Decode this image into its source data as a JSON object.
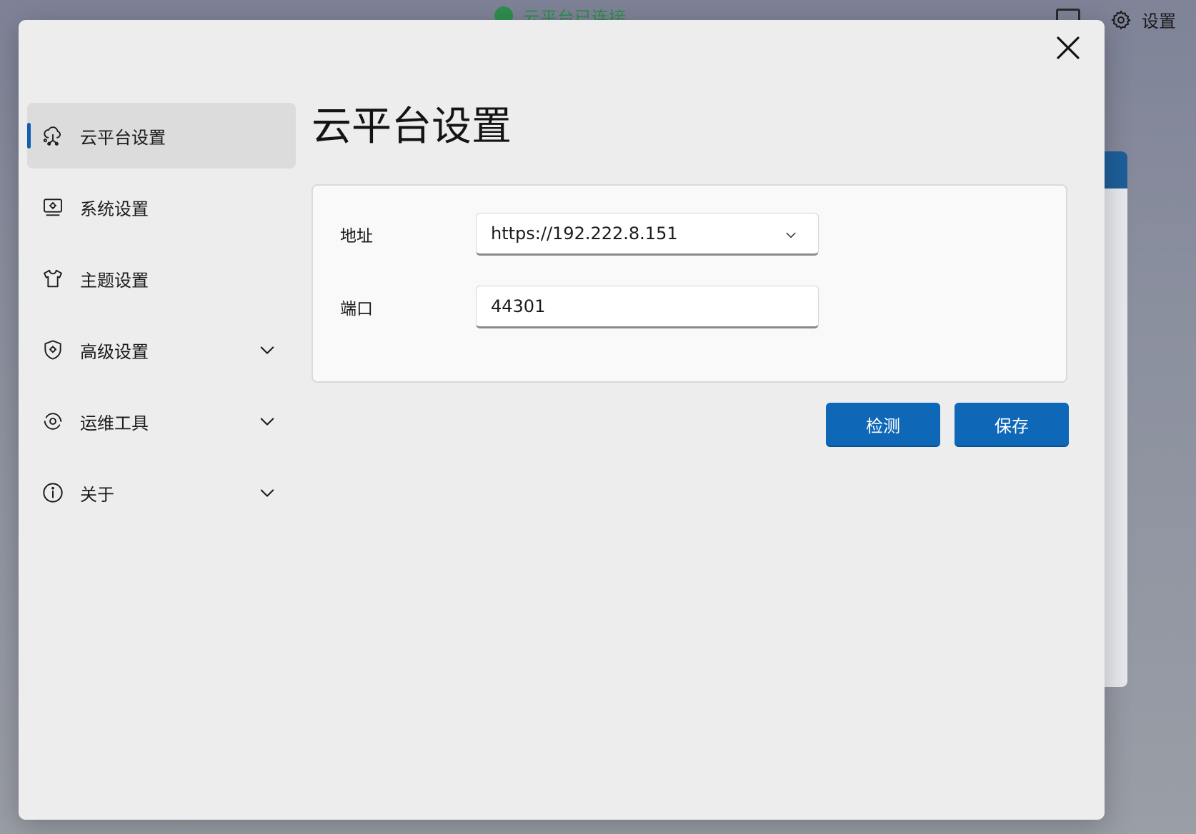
{
  "background": {
    "status_text": "云平台已连接",
    "settings_label": "设置"
  },
  "dialog": {
    "title": "云平台设置",
    "sidebar": {
      "items": [
        {
          "label": "云平台设置",
          "icon": "cloud-network-icon",
          "active": true,
          "expandable": false
        },
        {
          "label": "系统设置",
          "icon": "system-settings-icon",
          "active": false,
          "expandable": false
        },
        {
          "label": "主题设置",
          "icon": "tshirt-icon",
          "active": false,
          "expandable": false
        },
        {
          "label": "高级设置",
          "icon": "shield-gear-icon",
          "active": false,
          "expandable": true
        },
        {
          "label": "运维工具",
          "icon": "tools-cycle-icon",
          "active": false,
          "expandable": true
        },
        {
          "label": "关于",
          "icon": "info-icon",
          "active": false,
          "expandable": true
        }
      ]
    },
    "form": {
      "address_label": "地址",
      "address_value": "https://192.222.8.151",
      "port_label": "端口",
      "port_value": "44301"
    },
    "buttons": {
      "check": "检测",
      "save": "保存"
    }
  },
  "colors": {
    "accent": "#0f67b8",
    "dialog_bg": "#ededed",
    "status_green": "#2f8f4e"
  }
}
